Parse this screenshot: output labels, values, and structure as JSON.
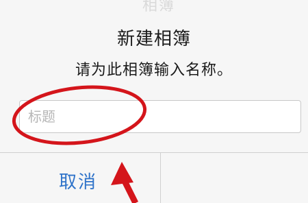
{
  "dialog": {
    "background_title": "相簿",
    "title": "新建相簿",
    "message": "请为此相簿输入名称。",
    "input": {
      "value": "",
      "placeholder": "标题"
    },
    "buttons": {
      "cancel_label": "取消",
      "save_label": ""
    }
  },
  "annotation": {
    "color": "#d4151b",
    "shapes": [
      "ellipse-highlight",
      "arrow"
    ]
  }
}
